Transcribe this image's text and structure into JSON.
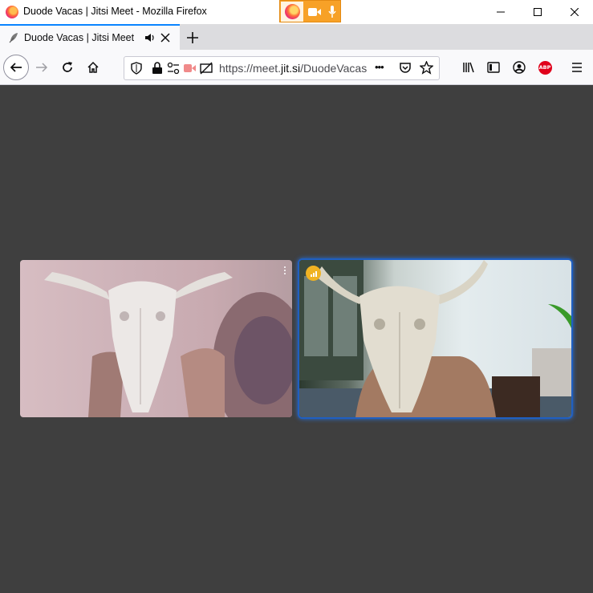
{
  "window": {
    "title": "Duode Vacas | Jitsi Meet - Mozilla Firefox",
    "controls": [
      "minimize-icon",
      "maximize-icon",
      "close-icon"
    ]
  },
  "sharing_indicator": {
    "icons": [
      "firefox-icon",
      "camera-icon",
      "microphone-icon"
    ],
    "color": "#f7a127"
  },
  "tabs": [
    {
      "title": "Duode Vacas | Jitsi Meet",
      "active": true,
      "audio": true
    }
  ],
  "navbar": {
    "url_prefix": "https://meet.",
    "url_domain": "jit.si",
    "url_path": "/DuodeVacas",
    "more_label": "•••"
  },
  "meeting": {
    "background": "#3f3f3f",
    "participants": [
      {
        "role": "remote",
        "has_menu": true
      },
      {
        "role": "local",
        "dominant_speaker": true,
        "connection_quality": "good",
        "highlight_color": "#1f5fc2",
        "indicator_color": "#f0b323"
      }
    ]
  }
}
